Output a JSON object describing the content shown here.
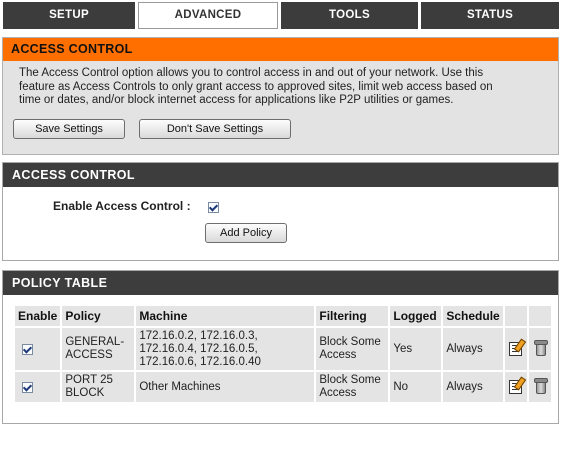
{
  "tabs": [
    {
      "label": "SETUP",
      "active": false
    },
    {
      "label": "ADVANCED",
      "active": true
    },
    {
      "label": "TOOLS",
      "active": false
    },
    {
      "label": "STATUS",
      "active": false
    }
  ],
  "info": {
    "title": "ACCESS CONTROL",
    "line1": "The Access Control option allows you to control access in and out of your network. Use this",
    "line2": "feature as Access Controls to only grant access to approved sites, limit web access based on",
    "line3": "time or dates, and/or block internet access for applications like P2P utilities or games.",
    "save_label": "Save Settings",
    "dont_save_label": "Don't Save Settings"
  },
  "access_control": {
    "title": "ACCESS CONTROL",
    "enable_label": "Enable Access Control :",
    "enable_checked": true,
    "add_policy_label": "Add Policy"
  },
  "policy_table": {
    "title": "POLICY TABLE",
    "headers": [
      "Enable",
      "Policy",
      "Machine",
      "Filtering",
      "Logged",
      "Schedule",
      "",
      ""
    ],
    "rows": [
      {
        "enabled": true,
        "policy_line1": "GENERAL-",
        "policy_line2": "ACCESS",
        "machine_line1": "172.16.0.2, 172.16.0.3,",
        "machine_line2": "172.16.0.4, 172.16.0.5,",
        "machine_line3": "172.16.0.6, 172.16.0.40",
        "filtering_line1": "Block Some",
        "filtering_line2": "Access",
        "logged": "Yes",
        "schedule": "Always",
        "edit_icon": "edit-icon",
        "delete_icon": "trash-icon"
      },
      {
        "enabled": true,
        "policy_line1": "PORT 25",
        "policy_line2": "BLOCK",
        "machine_line1": "Other Machines",
        "filtering_line1": "Block Some",
        "filtering_line2": "Access",
        "logged": "No",
        "schedule": "Always",
        "edit_icon": "edit-icon",
        "delete_icon": "trash-icon"
      }
    ]
  },
  "colors": {
    "orange_header": "#ff6f00",
    "dark_header": "#3d3d3d",
    "panel_bg": "#e3e3e3"
  }
}
